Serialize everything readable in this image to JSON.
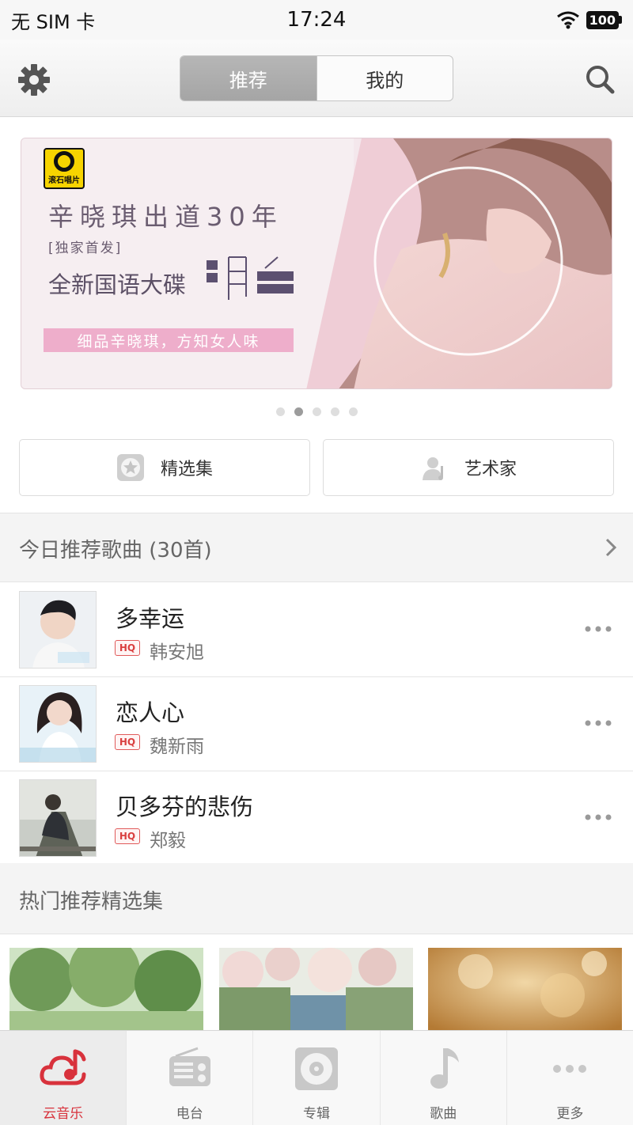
{
  "status_bar": {
    "carrier": "无 SIM 卡",
    "time": "17:24",
    "battery": "100"
  },
  "header": {
    "tabs": [
      {
        "label": "推荐",
        "active": true
      },
      {
        "label": "我的",
        "active": false
      }
    ],
    "left_icon": "gear-icon",
    "right_icon": "search-icon"
  },
  "banner": {
    "label_logo": "滚石唱片",
    "title": "辛晓琪出道30年",
    "exclusive": "[独家首发]",
    "subtitle": "全新国语大碟",
    "album_title": "明",
    "tagline": "细品辛晓琪，方知女人味",
    "pages": 5,
    "active_page": 2
  },
  "quick_links": [
    {
      "label": "精选集",
      "icon": "star-box-icon"
    },
    {
      "label": "艺术家",
      "icon": "artist-icon"
    }
  ],
  "daily_section": {
    "title": "今日推荐歌曲 (30首)"
  },
  "songs": [
    {
      "title": "多幸运",
      "artist": "韩安旭",
      "quality": "HQ"
    },
    {
      "title": "恋人心",
      "artist": "魏新雨",
      "quality": "HQ"
    },
    {
      "title": "贝多芬的悲伤",
      "artist": "郑毅",
      "quality": "HQ"
    }
  ],
  "hot_section": {
    "title": "热门推荐精选集"
  },
  "tabbar": [
    {
      "label": "云音乐",
      "icon": "cloud-music-icon",
      "active": true
    },
    {
      "label": "电台",
      "icon": "radio-icon",
      "active": false
    },
    {
      "label": "专辑",
      "icon": "album-icon",
      "active": false
    },
    {
      "label": "歌曲",
      "icon": "music-note-icon",
      "active": false
    },
    {
      "label": "更多",
      "icon": "more-icon",
      "active": false
    }
  ],
  "colors": {
    "accent": "#d8323c",
    "tagline_bg": "#eeaecb",
    "logo_yellow": "#f7d400"
  }
}
